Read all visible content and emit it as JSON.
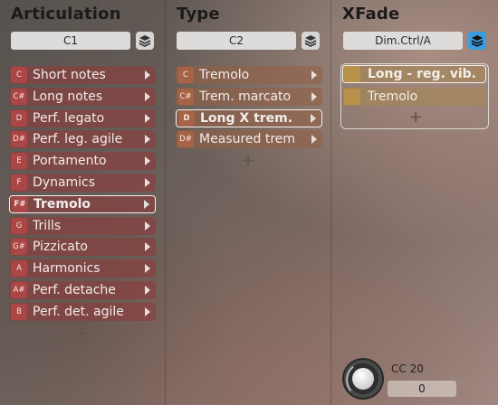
{
  "articulation": {
    "title": "Articulation",
    "selector": "C1",
    "items": [
      {
        "note": "C",
        "label": "Short notes"
      },
      {
        "note": "C#",
        "label": "Long notes"
      },
      {
        "note": "D",
        "label": "Perf. legato"
      },
      {
        "note": "D#",
        "label": "Perf. leg. agile"
      },
      {
        "note": "E",
        "label": "Portamento"
      },
      {
        "note": "F",
        "label": "Dynamics"
      },
      {
        "note": "F#",
        "label": "Tremolo",
        "selected": true
      },
      {
        "note": "G",
        "label": "Trills"
      },
      {
        "note": "G#",
        "label": "Pizzicato"
      },
      {
        "note": "A",
        "label": "Harmonics"
      },
      {
        "note": "A#",
        "label": "Perf. detache"
      },
      {
        "note": "B",
        "label": "Perf. det. agile"
      }
    ]
  },
  "type": {
    "title": "Type",
    "selector": "C2",
    "items": [
      {
        "note": "C",
        "label": "Tremolo"
      },
      {
        "note": "C#",
        "label": "Trem. marcato"
      },
      {
        "note": "D",
        "label": "Long X trem.",
        "selected": true
      },
      {
        "note": "D#",
        "label": "Measured trem"
      }
    ]
  },
  "xfade": {
    "title": "XFade",
    "selector": "Dim.Ctrl/A",
    "items": [
      {
        "label": "Long - reg. vib.",
        "selected": true
      },
      {
        "label": "Tremolo"
      }
    ]
  },
  "cc": {
    "label": "CC 20",
    "value": "0"
  },
  "icons": {
    "layers": "layers-icon",
    "arrow": "chevron-right-icon",
    "add": "plus-icon",
    "knob": "knob-icon"
  },
  "colors": {
    "accent_active": "#3a9de2",
    "articulation_item": "#8c3c3c",
    "type_item": "#965f41",
    "xfade_item": "#b8924a",
    "selected_border": "#f4f1f0"
  }
}
